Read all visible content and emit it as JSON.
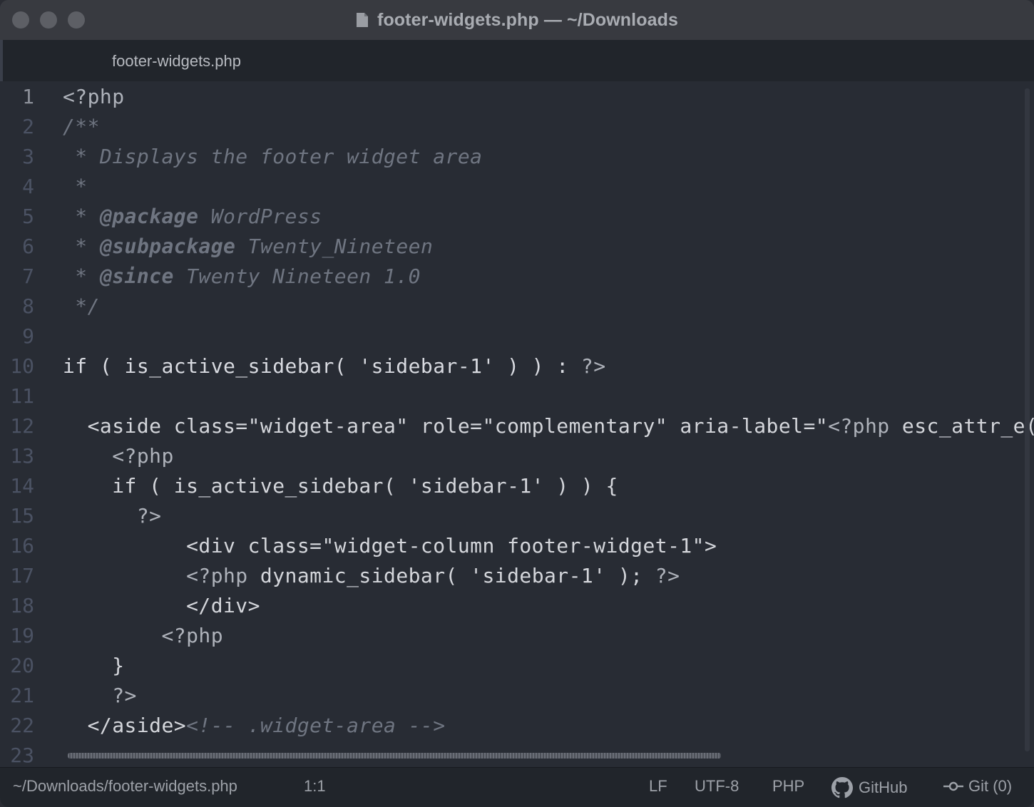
{
  "window": {
    "title": "footer-widgets.php — ~/Downloads"
  },
  "tab": {
    "label": "footer-widgets.php"
  },
  "editor": {
    "lines": [
      {
        "n": "1",
        "html": "<span class=\"tag\">&lt;?php</span>"
      },
      {
        "n": "2",
        "html": "<span class=\"cm\">/**</span>"
      },
      {
        "n": "3",
        "html": "<span class=\"cm\"> * Displays the footer widget area</span>"
      },
      {
        "n": "4",
        "html": "<span class=\"cm\"> *</span>"
      },
      {
        "n": "5",
        "html": "<span class=\"cm\"> * <b>@package</b> WordPress</span>"
      },
      {
        "n": "6",
        "html": "<span class=\"cm\"> * <b>@subpackage</b> Twenty_Nineteen</span>"
      },
      {
        "n": "7",
        "html": "<span class=\"cm\"> * <b>@since</b> Twenty Nineteen 1.0</span>"
      },
      {
        "n": "8",
        "html": "<span class=\"cm\"> */</span>"
      },
      {
        "n": "9",
        "html": ""
      },
      {
        "n": "10",
        "html": "<span class=\"kw\">if ( is_active_sidebar( 'sidebar-1' ) ) : </span><span class=\"tag\">?&gt;</span>"
      },
      {
        "n": "11",
        "html": ""
      },
      {
        "n": "12",
        "html": "  &lt;aside class=\"widget-area\" role=\"complementary\" aria-label=\"<span class=\"tag\">&lt;?php</span> esc_attr_e("
      },
      {
        "n": "13",
        "html": "    <span class=\"tag\">&lt;?php</span>"
      },
      {
        "n": "14",
        "html": "    if ( is_active_sidebar( 'sidebar-1' ) ) {"
      },
      {
        "n": "15",
        "html": "      <span class=\"tag\">?&gt;</span>"
      },
      {
        "n": "16",
        "html": "          &lt;div class=\"widget-column footer-widget-1\"&gt;"
      },
      {
        "n": "17",
        "html": "          <span class=\"tag\">&lt;?php</span> dynamic_sidebar( 'sidebar-1' ); <span class=\"tag\">?&gt;</span>"
      },
      {
        "n": "18",
        "html": "          &lt;/div&gt;"
      },
      {
        "n": "19",
        "html": "        <span class=\"tag\">&lt;?php</span>"
      },
      {
        "n": "20",
        "html": "    }"
      },
      {
        "n": "21",
        "html": "    <span class=\"tag\">?&gt;</span>"
      },
      {
        "n": "22",
        "html": "  &lt;/aside&gt;<span class=\"tagc\">&lt;!-- .widget-area --&gt;</span>"
      },
      {
        "n": "23",
        "html": ""
      }
    ]
  },
  "status_bar": {
    "path": "~/Downloads/footer-widgets.php",
    "cursor": "1:1",
    "line_ending": "LF",
    "encoding": "UTF-8",
    "grammar": "PHP",
    "github": "GitHub",
    "git": "Git (0)"
  }
}
